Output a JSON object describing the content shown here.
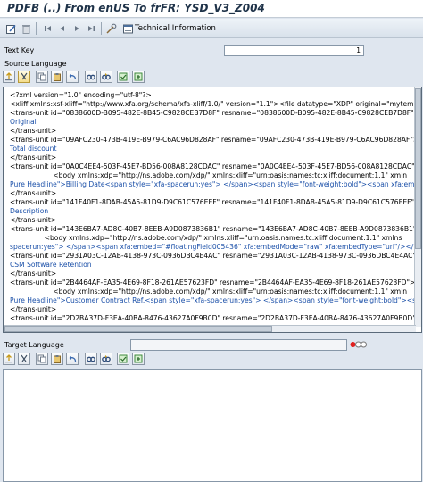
{
  "window": {
    "title": "PDFB (..) From enUS To frFR: YSD_V3_Z004"
  },
  "toolbar": {
    "technical_info_label": "Technical Information"
  },
  "text_key": {
    "label": "Text Key",
    "value": "1"
  },
  "source": {
    "label": "Source Language"
  },
  "target": {
    "label": "Target Language",
    "status_colors": [
      "#e0201f",
      "#d9d9d9",
      "#d9d9d9"
    ]
  },
  "editor_lines": [
    "<?xml version=\"1.0\" encoding=\"utf-8\"?>",
    "<xliff xmlns:xsf-xliff=\"http://www.xfa.org/schema/xfa-xliff/1.0/\" version=\"1.1\"><file datatype=\"XDP\" original=\"mytemplate.",
    "<trans-unit id=\"0838600D-B095-482E-8B45-C9828CEB7D8F\" resname=\"0838600D-B095-482E-8B45-C9828CEB7D8F\">",
    "Original",
    "</trans-unit>",
    "<trans-unit id=\"09AFC230-473B-419E-B979-C6AC96D828AF\" resname=\"09AFC230-473B-419E-B979-C6AC96D828AF\">",
    "Total discount",
    "</trans-unit>",
    "<trans-unit id=\"0A0C4EE4-503F-45E7-BD56-008A8128CDAC\" resname=\"0A0C4EE4-503F-45E7-BD56-008A8128CDAC\">",
    "                    <body xmlns:xdp=\"http://ns.adobe.com/xdp/\" xmlns:xliff=\"urn:oasis:names:tc:xliff:document:1.1\" xmln",
    "Pure Headline\">Billing Date<span style=\"xfa-spacerun:yes\"> </span><span style=\"font-weight:bold\"><span xfa:embed=\"",
    "</trans-unit>",
    "<trans-unit id=\"141F40F1-8DAB-45A5-81D9-D9C61C576EEF\" resname=\"141F40F1-8DAB-45A5-81D9-D9C61C576EEF\">",
    "Description",
    "</trans-unit>",
    "<trans-unit id=\"143E6BA7-AD8C-40B7-8EEB-A9D0873836B1\" resname=\"143E6BA7-AD8C-40B7-8EEB-A9D0873836B1\">",
    "                <body xmlns:xdp=\"http://ns.adobe.com/xdp/\" xmlns:xliff=\"urn:oasis:names:tc:xliff:document:1.1\" xmlns",
    "spacerun:yes\"> </span><span xfa:embed=\"#floatingField005436\" xfa:embedMode=\"raw\" xfa:embedType=\"uri\"/></p></body",
    "<trans-unit id=\"2931A03C-12AB-4138-973C-0936DBC4E4AC\" resname=\"2931A03C-12AB-4138-973C-0936DBC4E4AC\">",
    "CSM Software Retention",
    "</trans-unit>",
    "<trans-unit id=\"2B4464AF-EA35-4E69-8F18-261AE57623FD\" resname=\"2B4464AF-EA35-4E69-8F18-261AE57623FD\">",
    "                    <body xmlns:xdp=\"http://ns.adobe.com/xdp/\" xmlns:xliff=\"urn:oasis:names:tc:xliff:document:1.1\" xmln",
    "Pure Headline\">Customer Contract Ref.<span style=\"xfa-spacerun:yes\"> </span><span style=\"font-weight:bold\"><span xfa",
    "</trans-unit>",
    "<trans-unit id=\"2D2BA37D-F3EA-40BA-8476-43627A0F9B0D\" resname=\"2D2BA37D-F3EA-40BA-8476-43627A0F9B0D\">"
  ],
  "blue_lines": [
    3,
    6,
    10,
    13,
    17,
    19,
    23
  ]
}
